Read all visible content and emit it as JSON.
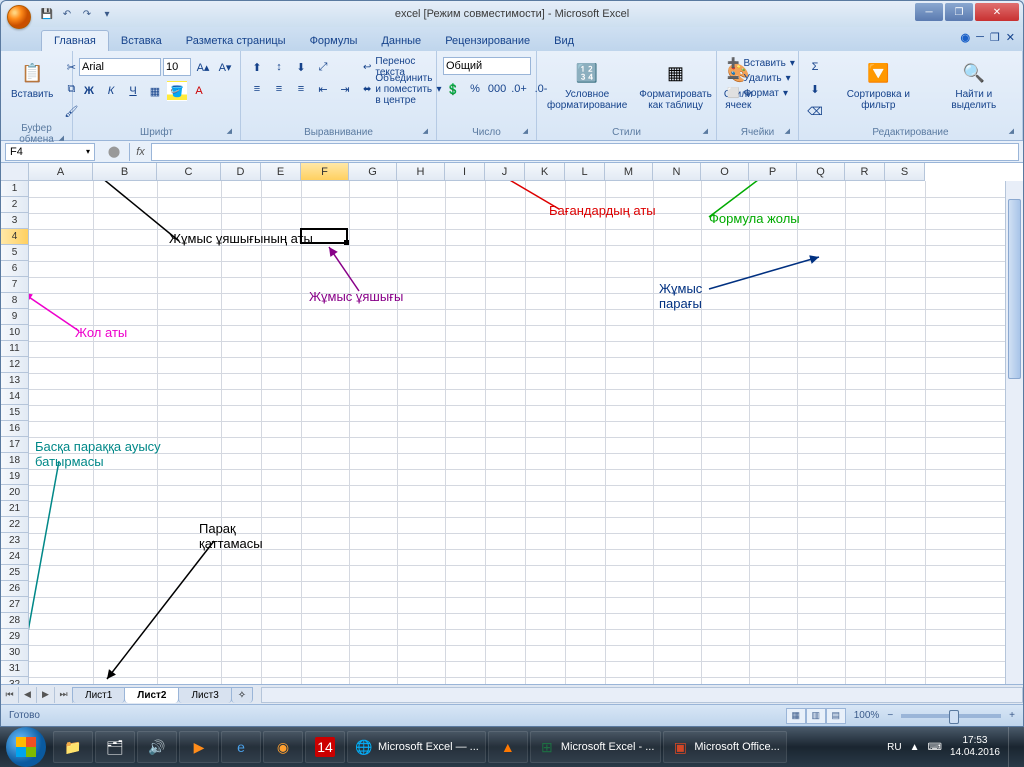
{
  "title": "excel  [Режим совместимости] - Microsoft Excel",
  "tabs": [
    "Главная",
    "Вставка",
    "Разметка страницы",
    "Формулы",
    "Данные",
    "Рецензирование",
    "Вид"
  ],
  "active_tab": 0,
  "ribbon": {
    "clipboard": {
      "label": "Буфер обмена",
      "paste": "Вставить"
    },
    "font": {
      "label": "Шрифт",
      "name": "Arial",
      "size": "10",
      "bold": "Ж",
      "italic": "К",
      "underline": "Ч"
    },
    "alignment": {
      "label": "Выравнивание",
      "wrap": "Перенос текста",
      "merge": "Объединить и поместить в центре"
    },
    "number": {
      "label": "Число",
      "format": "Общий"
    },
    "styles": {
      "label": "Стили",
      "cond": "Условное форматирование",
      "table": "Форматировать как таблицу",
      "cell": "Стили ячеек"
    },
    "cells": {
      "label": "Ячейки",
      "insert": "Вставить",
      "delete": "Удалить",
      "format": "Формат"
    },
    "editing": {
      "label": "Редактирование",
      "sort": "Сортировка и фильтр",
      "find": "Найти и выделить"
    }
  },
  "name_box": "F4",
  "columns": [
    "A",
    "B",
    "C",
    "D",
    "E",
    "F",
    "G",
    "H",
    "I",
    "J",
    "K",
    "L",
    "M",
    "N",
    "O",
    "P",
    "Q",
    "R",
    "S"
  ],
  "selected_col": "F",
  "selected_row": 4,
  "row_count": 32,
  "sheets": [
    "Лист1",
    "Лист2",
    "Лист3"
  ],
  "active_sheet": 1,
  "status": {
    "ready": "Готово",
    "zoom": "100%"
  },
  "annotations": {
    "cell_name": "Жұмыс ұяшығының аты",
    "work_cell": "Жұмыс ұяшығы",
    "col_names": "Бағандардың аты",
    "formula_bar": "Формула жолы",
    "row_name": "Жол аты",
    "worksheet": "Жұмыс парағы",
    "sheet_switch": "Басқа параққа ауысу батырмасы",
    "sheet_tab": "Парақ қаттамасы"
  },
  "taskbar": {
    "items": [
      "Microsoft Excel — ...",
      "Microsoft Excel - ...",
      "Microsoft Office..."
    ],
    "lang": "RU",
    "time": "17:53",
    "date": "14.04.2016"
  }
}
